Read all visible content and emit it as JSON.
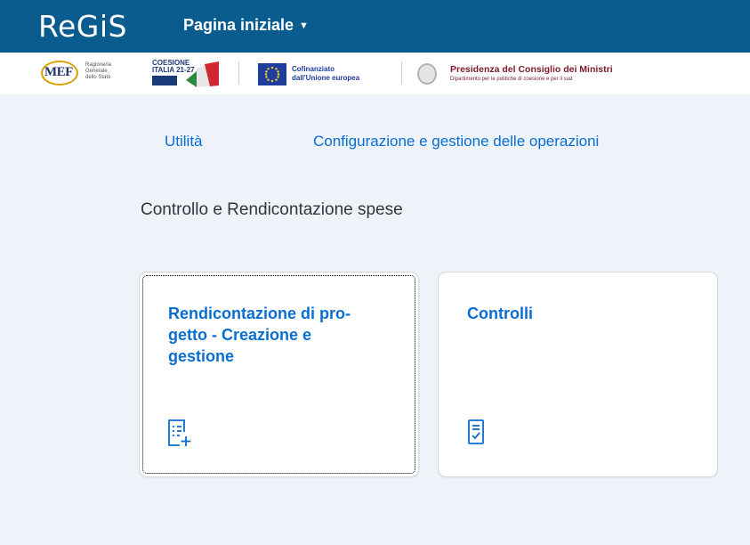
{
  "header": {
    "logo": "ReGiS",
    "home_menu": "Pagina iniziale",
    "home_caret": "▼"
  },
  "logos": {
    "mef": "MEF",
    "mef_caption": [
      "Ragioneria",
      "Generale",
      "dello Stato"
    ],
    "coesione_line1": "COESIONE",
    "coesione_line2": "ITALIA 21-27",
    "eu_line1": "Cofinanziato",
    "eu_line2": "dall'Unione europea",
    "presidency_title": "Presidenza del Consiglio dei Ministri",
    "presidency_sub": "Dipartimento per le politiche di coesione e per il sud"
  },
  "nav": {
    "links": [
      "Utilità",
      "Configurazione e gestione delle operazioni"
    ]
  },
  "section": {
    "title": "Controllo e Rendicontazione spese"
  },
  "tiles": [
    {
      "title": "Rendicontazione di pro-\ngetto - Creazione e\ngestione",
      "icon": "list-add-icon"
    },
    {
      "title": "Controlli",
      "icon": "checklist-icon"
    }
  ],
  "colors": {
    "header_bg": "#0a5b8e",
    "link": "#0a6ed1",
    "page_bg": "#edf3f9"
  }
}
